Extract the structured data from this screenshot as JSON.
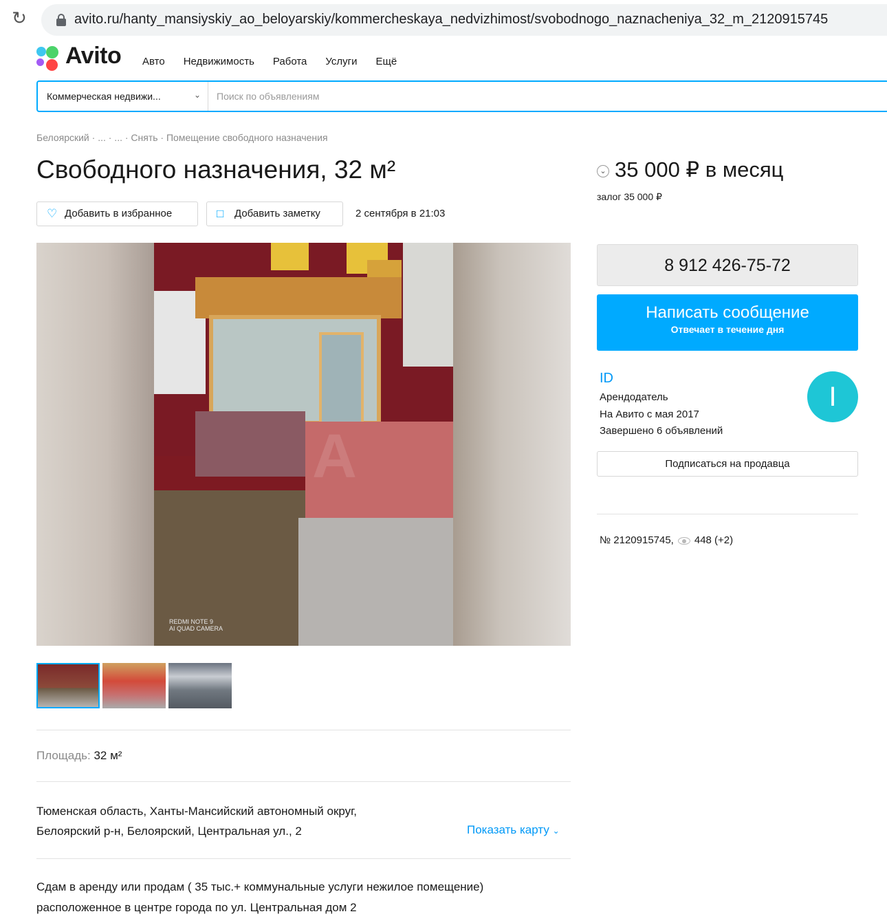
{
  "browser": {
    "url": "avito.ru/hanty_mansiyskiy_ao_beloyarskiy/kommercheskaya_nedvizhimost/svobodnogo_naznacheniya_32_m_2120915745",
    "reload_icon": "reload-icon",
    "lock_icon": "lock-icon"
  },
  "header": {
    "logo": "Avito",
    "nav": [
      "Авто",
      "Недвижимость",
      "Работа",
      "Услуги",
      "Ещё"
    ],
    "search": {
      "category": "Коммерческая недвижи...",
      "placeholder": "Поиск по объявлениям"
    }
  },
  "breadcrumbs": "Белоярский · ... · ... · Снять · Помещение свободного назначения",
  "listing": {
    "title": "Свободного назначения, 32 м²",
    "favorite_label": "Добавить в избранное",
    "note_label": "Добавить заметку",
    "date": "2 сентября в 21:03",
    "photo_caption": "REDMI NOTE 9\nAI QUAD CAMERA",
    "area_label": "Площадь:",
    "area_value": "32 м²",
    "address_line1": "Тюменская область, Ханты-Мансийский автономный округ,",
    "address_line2": "Белоярский р-н, Белоярский, Центральная ул., 2",
    "show_map": "Показать карту",
    "description_line1": "Сдам в аренду или продам ( 35 тыс.+ коммунальные услуги нежилое помещение)",
    "description_line2": "расположенное в центре города по ул. Центральная дом 2"
  },
  "sidebar": {
    "price": "35 000 ₽ в месяц",
    "deposit": "залог 35 000 ₽",
    "phone": "8 912 426-75-72",
    "message_button": "Написать сообщение",
    "message_sub": "Отвечает в течение дня",
    "seller_name": "ID",
    "seller_type": "Арендодатель",
    "seller_since": "На Авито с мая 2017",
    "seller_done": "Завершено 6 объявлений",
    "avatar_letter": "I",
    "subscribe": "Подписаться на продавца",
    "listing_no": "№ 2120915745,",
    "views": "448 (+2)"
  },
  "colors": {
    "accent": "#00aaff",
    "link": "#0099f7",
    "avatar": "#1ec6d6"
  }
}
